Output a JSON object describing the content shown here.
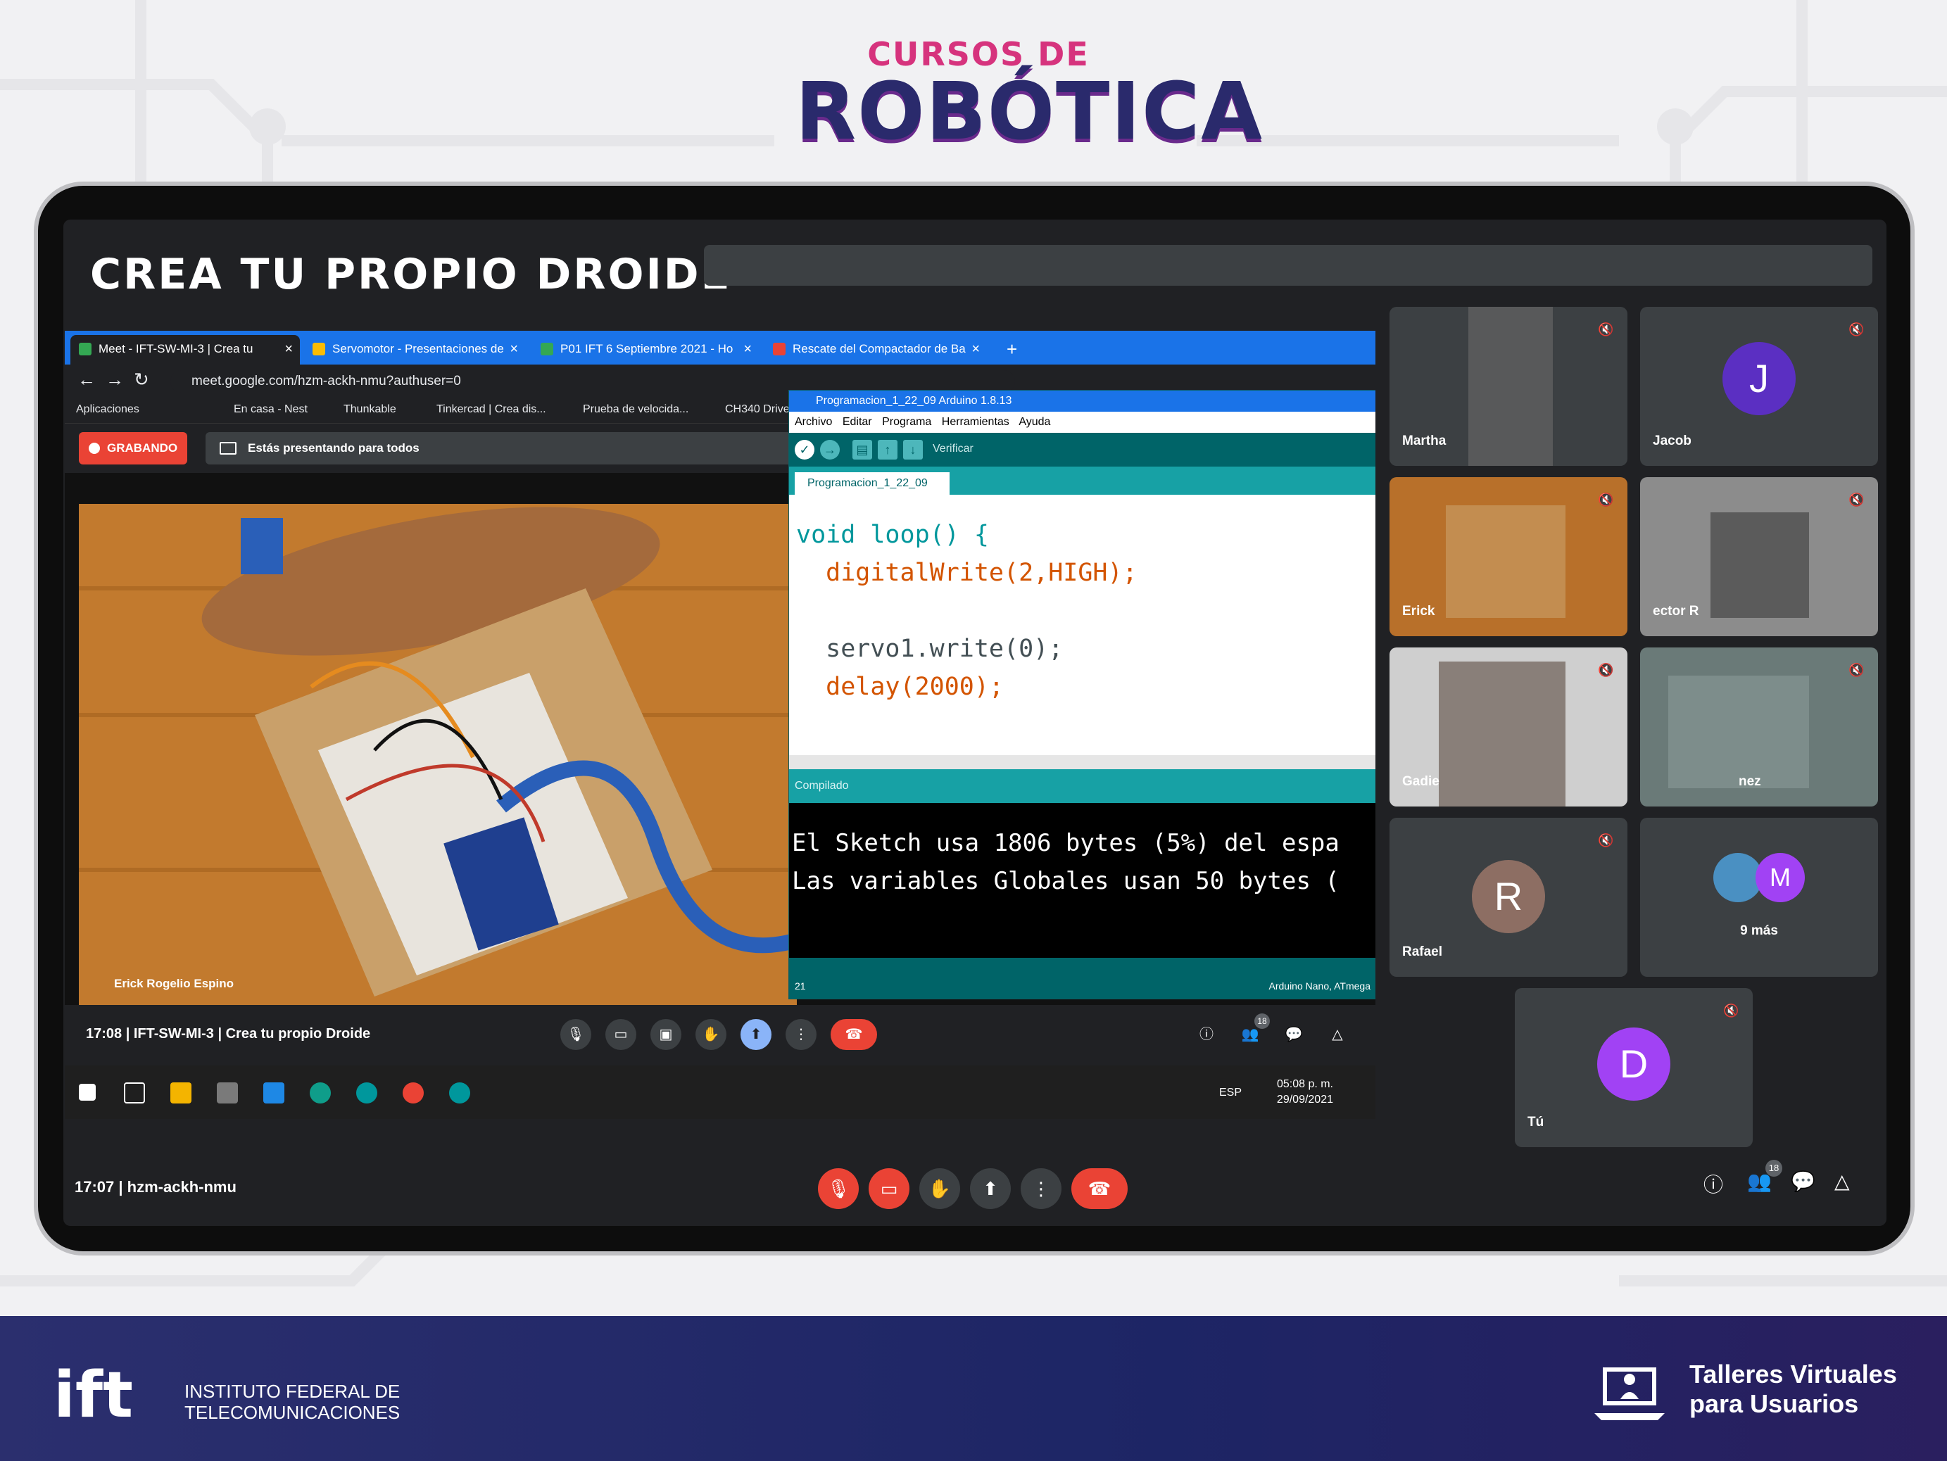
{
  "banner": {
    "line1": "CURSOS DE",
    "line2": "ROBÓTICA"
  },
  "main_title": "CREA TU PROPIO DROIDE",
  "browser": {
    "tabs": [
      "Meet - IFT-SW-MI-3 | Crea tu",
      "Servomotor - Presentaciones de",
      "P01 IFT 6 Septiembre 2021 - Ho",
      "Rescate del Compactador de Ba"
    ],
    "new_tab": "+",
    "url": "meet.google.com/hzm-ackh-nmu?authuser=0",
    "bookmarks": [
      "Aplicaciones",
      "En casa - Nest",
      "Thunkable",
      "Tinkercad | Crea dis...",
      "Prueba de velocida...",
      "CH340 Drive"
    ]
  },
  "meet_inner": {
    "rec_label": "GRABANDO",
    "presenting_label": "Estás presentando para todos",
    "video_name": "Erick Rogelio Espino",
    "time": "17:08",
    "meeting": "IFT-SW-MI-3 | Crea tu propio Droide",
    "participants_count": "18"
  },
  "arduino": {
    "title": "Programacion_1_22_09 Arduino 1.8.13",
    "menu": [
      "Archivo",
      "Editar",
      "Programa",
      "Herramientas",
      "Ayuda"
    ],
    "verify_label": "Verificar",
    "tab": "Programacion_1_22_09",
    "code_line1": "void loop() {",
    "code_line2": "  digitalWrite(2,HIGH);",
    "code_line4": "  servo1.write(0);",
    "code_line5": "  delay(2000);",
    "status": "Compilado",
    "console_line1": "El Sketch usa 1806 bytes (5%) del espa",
    "console_line2": "Las variables Globales usan 50 bytes (",
    "foot_left": "21",
    "foot_right": "Arduino Nano, ATmega"
  },
  "taskbar": {
    "lang": "ESP",
    "time": "05:08 p. m.",
    "date": "29/09/2021"
  },
  "participants": [
    {
      "name": "Martha"
    },
    {
      "name": "Jacob",
      "initial": "J",
      "color": "#5b2fc2"
    },
    {
      "name": "Erick"
    },
    {
      "name": "ector R"
    },
    {
      "name": "Gadie"
    },
    {
      "name": "nez"
    },
    {
      "name": "Rafael",
      "initial": "R",
      "color": "#8d6e63"
    },
    {
      "more": "9 más",
      "initial": "M",
      "color": "#a142f4"
    },
    {
      "name": "Tú",
      "initial": "D",
      "color": "#a142f4"
    }
  ],
  "bottom_bar": {
    "time": "17:07",
    "code": "hzm-ackh-nmu",
    "participants_count": "18"
  },
  "footer": {
    "ift": "ift",
    "ift_line1": "INSTITUTO FEDERAL DE",
    "ift_line2": "TELECOMUNICACIONES",
    "tv_line1": "Talleres Virtuales",
    "tv_line2": "para Usuarios"
  },
  "colors": {
    "meet_red": "#ea4335",
    "meet_dark": "#202124",
    "arduino_teal": "#006468",
    "footer_navy": "#1d2565"
  }
}
